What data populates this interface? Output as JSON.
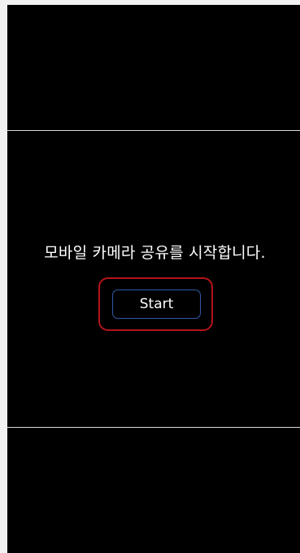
{
  "screen": {
    "message": "모바일 카메라 공유를 시작합니다.",
    "start_button_label": "Start"
  },
  "colors": {
    "background": "#000000",
    "text": "#ffffff",
    "button_border": "#2e5aa6",
    "highlight_border": "#b3141a",
    "frame_edge": "#f2f2f2"
  }
}
